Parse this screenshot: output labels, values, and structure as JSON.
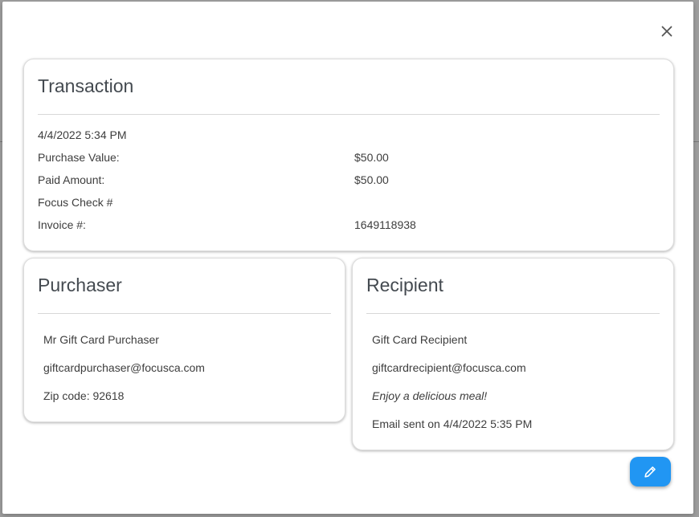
{
  "transaction": {
    "title": "Transaction",
    "datetime": "4/4/2022 5:34 PM",
    "rows": [
      {
        "label": "Purchase Value:",
        "value": "$50.00"
      },
      {
        "label": "Paid Amount:",
        "value": "$50.00"
      },
      {
        "label": "Focus Check #",
        "value": ""
      },
      {
        "label": "Invoice #:",
        "value": "1649118938"
      }
    ]
  },
  "purchaser": {
    "title": "Purchaser",
    "name": "Mr Gift Card Purchaser",
    "email": "giftcardpurchaser@focusca.com",
    "zip": "Zip code: 92618"
  },
  "recipient": {
    "title": "Recipient",
    "name": "Gift Card Recipient",
    "email": "giftcardrecipient@focusca.com",
    "message": "Enjoy a delicious meal!",
    "email_sent": "Email sent on 4/4/2022 5:35 PM"
  },
  "icons": {
    "close": "close-icon",
    "edit": "pencil-icon"
  },
  "colors": {
    "accent": "#2196f3",
    "text": "#3d3d3d",
    "title": "#444a50"
  }
}
